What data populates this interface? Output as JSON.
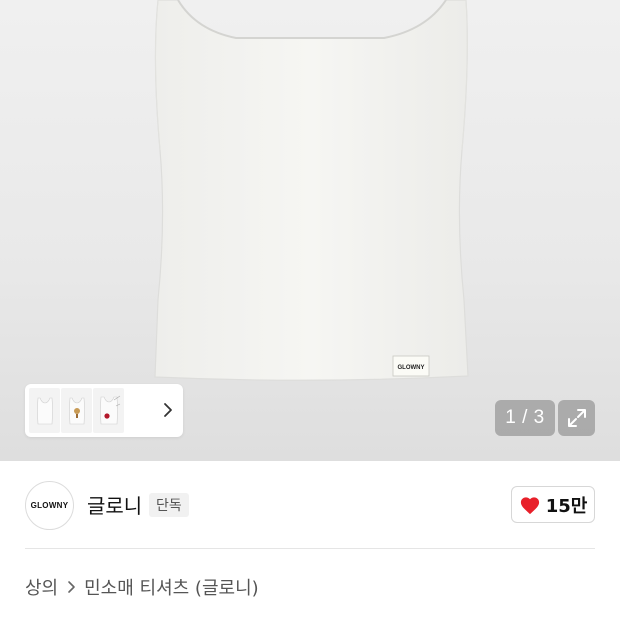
{
  "gallery": {
    "current": 1,
    "total": 3,
    "counter_text": "1 / 3",
    "product_label_text": "GLOWNY",
    "thumbnails": [
      "thumbnail-1",
      "thumbnail-2",
      "thumbnail-3"
    ]
  },
  "brand": {
    "logo_text": "GLOWNY",
    "name": "글로니",
    "badge": "단독"
  },
  "likes": {
    "count": "15만",
    "icon": "heart-icon",
    "color": "#e8202a"
  },
  "breadcrumb": {
    "category": "상의",
    "subcategory": "민소매 티셔츠 (글로니)"
  }
}
